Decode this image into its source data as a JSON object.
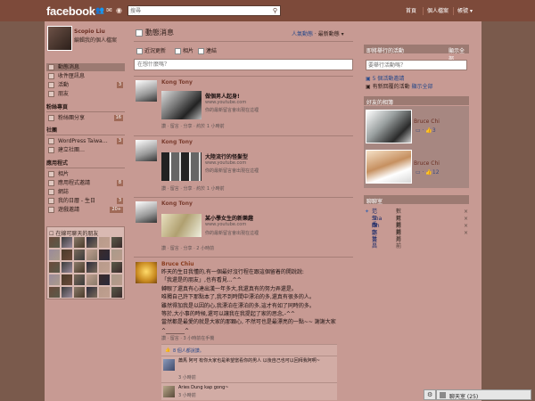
{
  "topbar": {
    "logo": "facebook",
    "search_placeholder": "搜尋",
    "nav": [
      "首頁",
      "個人檔案",
      "帳號"
    ]
  },
  "profile": {
    "name": "Scopio Liu",
    "edit_label": "編輯我的個人檔案"
  },
  "sidebar": {
    "items": [
      {
        "label": "動態消息",
        "count": ""
      },
      {
        "label": "收件匣訊息",
        "count": ""
      },
      {
        "label": "活動",
        "count": "3"
      },
      {
        "label": "朋友",
        "count": ""
      }
    ],
    "fanpages_title": "粉絲專頁",
    "fanpages": [
      {
        "label": "粉絲團分享",
        "count": "16"
      }
    ],
    "groups_title": "社團",
    "groups": [
      {
        "label": "WordPress Taiwa…",
        "count": "3"
      },
      {
        "label": "建立社團…",
        "count": ""
      }
    ],
    "apps_title": "應用程式",
    "apps": [
      {
        "label": "相片",
        "count": ""
      },
      {
        "label": "應用程式邀請",
        "count": "8"
      },
      {
        "label": "網誌",
        "count": ""
      },
      {
        "label": "我的日曆 - 生日",
        "count": "3"
      },
      {
        "label": "遊戲邀請",
        "count": "20+"
      }
    ],
    "chat_header": "在線可聊天的朋友"
  },
  "main": {
    "title": "動態消息",
    "sort_top": "人氣動態",
    "sort_recent": "最新動態",
    "composer_tabs": [
      "近況更新",
      "相片",
      "連結"
    ],
    "composer_placeholder": "在想什麼嗎？",
    "posts": [
      {
        "author": "Kong Tony",
        "link_title": "做個男人起身!",
        "link_url": "www.youtube.com",
        "link_desc": "你的最新留言會出現在這裡",
        "meta": "讚 · 留言 · 分享 · 約於 1 小時前"
      },
      {
        "author": "Kong Tony",
        "link_title": "大陸流行的怪髮型",
        "link_url": "www.youtube.com",
        "link_desc": "你的最新留言會出現在這裡",
        "meta": "讚 · 留言 · 分享 · 約於 1 小時前"
      },
      {
        "author": "Kong Tony",
        "link_title": "某小學女生的新樂趣",
        "link_url": "www.youtube.com",
        "link_desc": "你的最新留言會出現在這裡",
        "meta": "讚 · 留言 · 分享 · 2 小時前"
      }
    ],
    "status_post": {
      "author": "Bruce Chiu",
      "body": "昨天的生日我懂的,有一個最好沒行程在跟這個留着的開說說:\n「我還是的朋友」,也有看見...^^\n轉眼了還真有心達出漢一年多大,我還真有的努力弄還是。\n唯獨自己許下那點本了,我不到時間中漂泊的多,還真有很多的人。\n雖然得加我是以因的心,我漂泊在漂泊的多,這才有如了同時的多。\n等於,大小事的時候,還可以讓我在我提起了家的思念,-^^\n當然都是最愛的就是大家的那顆心, 不然可也是最漂亮的一點~~ 謝謝大家 ^_______^",
      "meta": "讚 · 留言 · 3 小時前在手機",
      "likes": "8 個人都說讚。",
      "comments": [
        {
          "text": "蕭馬 阿可 有你大家也是希望當看你的男人 以後自己也可以回拜我阿啊~",
          "time": "3 小時前"
        },
        {
          "text": "Aries Dung kap gong~",
          "time": "3 小時前"
        }
      ]
    }
  },
  "right": {
    "events_title": "即將舉行的活動",
    "events_action": "顯示全部",
    "events_input": "要舉行活動嗎？",
    "event_items": [
      "5 個活動邀請",
      "有新回覆的活動"
    ],
    "event_show_all": "顯示全部",
    "suggest_title": "好友的相簿",
    "suggest": [
      {
        "name": "Bruce Chi",
        "stats": "3"
      },
      {
        "name": "Bruce Chi",
        "stats": "12"
      }
    ],
    "friends_title": "聊聊室",
    "friends": [
      {
        "name": "范玉秀",
        "time": "數月前"
      },
      {
        "name": "Sha Oh",
        "time": "數月前"
      },
      {
        "name": "陳宗哲",
        "time": "數月前"
      },
      {
        "name": "鄭美昌",
        "time": "數月前"
      }
    ]
  },
  "chatdock": {
    "label": "聊天室 (25)"
  }
}
